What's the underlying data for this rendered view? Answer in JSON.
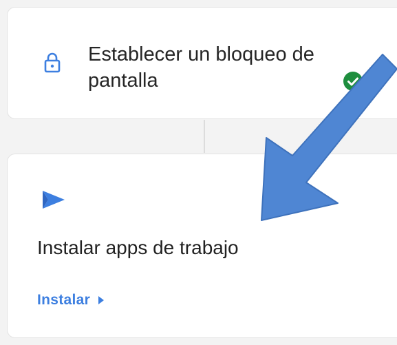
{
  "screen_lock_card": {
    "title": "Establecer un bloqueo de pantalla",
    "icon": "lock-icon",
    "status_icon": "check-circle-icon",
    "status_color": "#1e8e3e"
  },
  "work_apps_card": {
    "icon": "play-store-icon",
    "icon_color": "#3d7fe0",
    "title": "Instalar apps de trabajo",
    "action_label": "Instalar",
    "action_icon": "caret-right-icon",
    "action_color": "#3d7fe0"
  },
  "annotation": {
    "icon": "pointer-arrow",
    "color": "#4f86d3"
  }
}
